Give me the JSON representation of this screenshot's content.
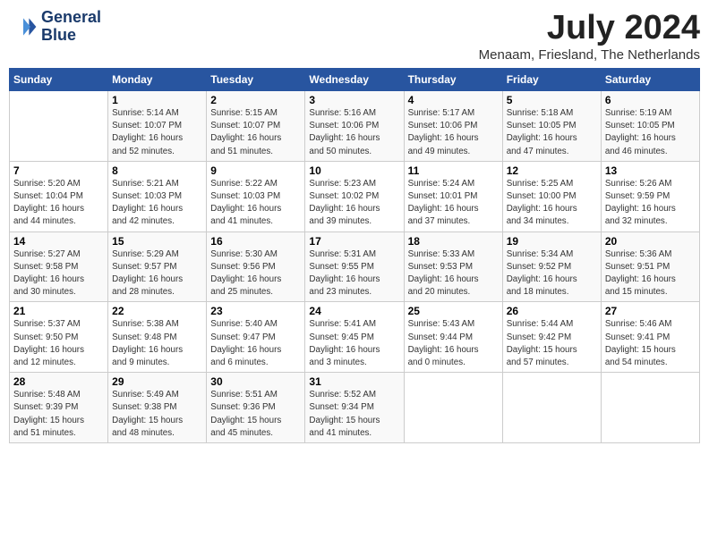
{
  "header": {
    "logo_line1": "General",
    "logo_line2": "Blue",
    "month_year": "July 2024",
    "location": "Menaam, Friesland, The Netherlands"
  },
  "days_of_week": [
    "Sunday",
    "Monday",
    "Tuesday",
    "Wednesday",
    "Thursday",
    "Friday",
    "Saturday"
  ],
  "weeks": [
    [
      {
        "day": "",
        "info": ""
      },
      {
        "day": "1",
        "info": "Sunrise: 5:14 AM\nSunset: 10:07 PM\nDaylight: 16 hours\nand 52 minutes."
      },
      {
        "day": "2",
        "info": "Sunrise: 5:15 AM\nSunset: 10:07 PM\nDaylight: 16 hours\nand 51 minutes."
      },
      {
        "day": "3",
        "info": "Sunrise: 5:16 AM\nSunset: 10:06 PM\nDaylight: 16 hours\nand 50 minutes."
      },
      {
        "day": "4",
        "info": "Sunrise: 5:17 AM\nSunset: 10:06 PM\nDaylight: 16 hours\nand 49 minutes."
      },
      {
        "day": "5",
        "info": "Sunrise: 5:18 AM\nSunset: 10:05 PM\nDaylight: 16 hours\nand 47 minutes."
      },
      {
        "day": "6",
        "info": "Sunrise: 5:19 AM\nSunset: 10:05 PM\nDaylight: 16 hours\nand 46 minutes."
      }
    ],
    [
      {
        "day": "7",
        "info": "Sunrise: 5:20 AM\nSunset: 10:04 PM\nDaylight: 16 hours\nand 44 minutes."
      },
      {
        "day": "8",
        "info": "Sunrise: 5:21 AM\nSunset: 10:03 PM\nDaylight: 16 hours\nand 42 minutes."
      },
      {
        "day": "9",
        "info": "Sunrise: 5:22 AM\nSunset: 10:03 PM\nDaylight: 16 hours\nand 41 minutes."
      },
      {
        "day": "10",
        "info": "Sunrise: 5:23 AM\nSunset: 10:02 PM\nDaylight: 16 hours\nand 39 minutes."
      },
      {
        "day": "11",
        "info": "Sunrise: 5:24 AM\nSunset: 10:01 PM\nDaylight: 16 hours\nand 37 minutes."
      },
      {
        "day": "12",
        "info": "Sunrise: 5:25 AM\nSunset: 10:00 PM\nDaylight: 16 hours\nand 34 minutes."
      },
      {
        "day": "13",
        "info": "Sunrise: 5:26 AM\nSunset: 9:59 PM\nDaylight: 16 hours\nand 32 minutes."
      }
    ],
    [
      {
        "day": "14",
        "info": "Sunrise: 5:27 AM\nSunset: 9:58 PM\nDaylight: 16 hours\nand 30 minutes."
      },
      {
        "day": "15",
        "info": "Sunrise: 5:29 AM\nSunset: 9:57 PM\nDaylight: 16 hours\nand 28 minutes."
      },
      {
        "day": "16",
        "info": "Sunrise: 5:30 AM\nSunset: 9:56 PM\nDaylight: 16 hours\nand 25 minutes."
      },
      {
        "day": "17",
        "info": "Sunrise: 5:31 AM\nSunset: 9:55 PM\nDaylight: 16 hours\nand 23 minutes."
      },
      {
        "day": "18",
        "info": "Sunrise: 5:33 AM\nSunset: 9:53 PM\nDaylight: 16 hours\nand 20 minutes."
      },
      {
        "day": "19",
        "info": "Sunrise: 5:34 AM\nSunset: 9:52 PM\nDaylight: 16 hours\nand 18 minutes."
      },
      {
        "day": "20",
        "info": "Sunrise: 5:36 AM\nSunset: 9:51 PM\nDaylight: 16 hours\nand 15 minutes."
      }
    ],
    [
      {
        "day": "21",
        "info": "Sunrise: 5:37 AM\nSunset: 9:50 PM\nDaylight: 16 hours\nand 12 minutes."
      },
      {
        "day": "22",
        "info": "Sunrise: 5:38 AM\nSunset: 9:48 PM\nDaylight: 16 hours\nand 9 minutes."
      },
      {
        "day": "23",
        "info": "Sunrise: 5:40 AM\nSunset: 9:47 PM\nDaylight: 16 hours\nand 6 minutes."
      },
      {
        "day": "24",
        "info": "Sunrise: 5:41 AM\nSunset: 9:45 PM\nDaylight: 16 hours\nand 3 minutes."
      },
      {
        "day": "25",
        "info": "Sunrise: 5:43 AM\nSunset: 9:44 PM\nDaylight: 16 hours\nand 0 minutes."
      },
      {
        "day": "26",
        "info": "Sunrise: 5:44 AM\nSunset: 9:42 PM\nDaylight: 15 hours\nand 57 minutes."
      },
      {
        "day": "27",
        "info": "Sunrise: 5:46 AM\nSunset: 9:41 PM\nDaylight: 15 hours\nand 54 minutes."
      }
    ],
    [
      {
        "day": "28",
        "info": "Sunrise: 5:48 AM\nSunset: 9:39 PM\nDaylight: 15 hours\nand 51 minutes."
      },
      {
        "day": "29",
        "info": "Sunrise: 5:49 AM\nSunset: 9:38 PM\nDaylight: 15 hours\nand 48 minutes."
      },
      {
        "day": "30",
        "info": "Sunrise: 5:51 AM\nSunset: 9:36 PM\nDaylight: 15 hours\nand 45 minutes."
      },
      {
        "day": "31",
        "info": "Sunrise: 5:52 AM\nSunset: 9:34 PM\nDaylight: 15 hours\nand 41 minutes."
      },
      {
        "day": "",
        "info": ""
      },
      {
        "day": "",
        "info": ""
      },
      {
        "day": "",
        "info": ""
      }
    ]
  ]
}
